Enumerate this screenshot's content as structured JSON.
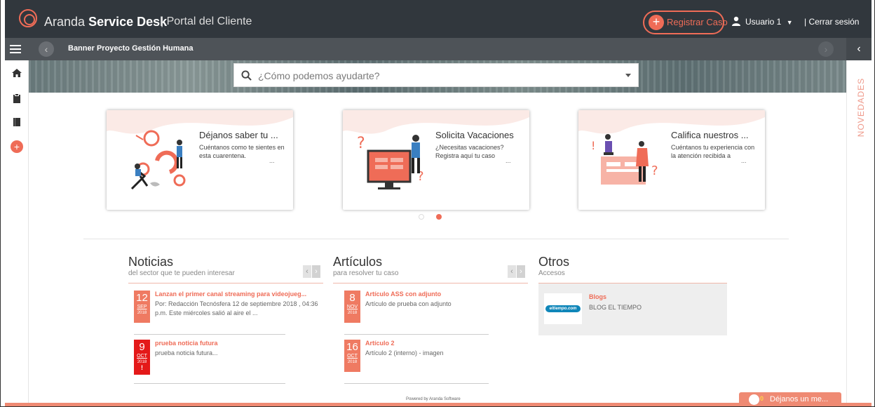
{
  "header": {
    "brand_light": "Aranda",
    "brand_bold": "Service Desk",
    "portal": "| Portal del Cliente",
    "register_button": "Registrar Caso",
    "user": "Usuario 1",
    "logout": "| Cerrar sesión"
  },
  "navbar": {
    "banner_title": "Banner Proyecto Gestión Humana"
  },
  "search": {
    "placeholder": "¿Cómo podemos ayudarte?"
  },
  "side_panel": {
    "label": "NOVEDADES"
  },
  "cards": [
    {
      "title": "Déjanos saber tu ...",
      "desc": "Cuéntanos como te sientes en esta cuarentena.",
      "more": "..."
    },
    {
      "title": "Solicita Vacaciones",
      "desc": "¿Necesitas vacaciones? Registra aquí tu caso",
      "more": "..."
    },
    {
      "title": "Califica nuestros ...",
      "desc": "Cuéntanos tu experiencia con la atención recibida a",
      "more": "..."
    }
  ],
  "noticias": {
    "title": "Noticias",
    "subtitle": "del sector que te pueden interesar",
    "items": [
      {
        "day": "12",
        "month": "SEP",
        "year": "2018",
        "title": "Lanzan el primer canal streaming para videojueg...",
        "desc": "Por: Redacción Tecnósfera 12 de septiembre 2018 , 04:36 p.m. Este miércoles salió al aire el ..."
      },
      {
        "day": "9",
        "month": "OCT",
        "year": "2018",
        "title": "prueba noticia futura",
        "desc": "prueba noticia futura...",
        "flag": "!"
      }
    ]
  },
  "articulos": {
    "title": "Artículos",
    "subtitle": "para resolver tu caso",
    "items": [
      {
        "day": "8",
        "month": "NOV",
        "year": "2018",
        "title": "Artículo ASS con adjunto",
        "desc": "Artículo de prueba con adjunto"
      },
      {
        "day": "16",
        "month": "OCT",
        "year": "2018",
        "title": "Artículo 2",
        "desc": "Artículo 2 (interno) - imagen"
      }
    ]
  },
  "otros": {
    "title": "Otros",
    "subtitle": "Accesos",
    "items": [
      {
        "logo_text": "eltiempo.com",
        "title": "Blogs",
        "desc": "BLOG EL TIEMPO"
      }
    ]
  },
  "footer": {
    "powered": "Powered by Aranda Software",
    "chat_badge": "0",
    "chat_label": "Déjanos un me..."
  },
  "colors": {
    "accent": "#ef6c57",
    "header_bg": "#31373d",
    "navbar_bg": "#4e5358",
    "urgent": "#e41919"
  }
}
